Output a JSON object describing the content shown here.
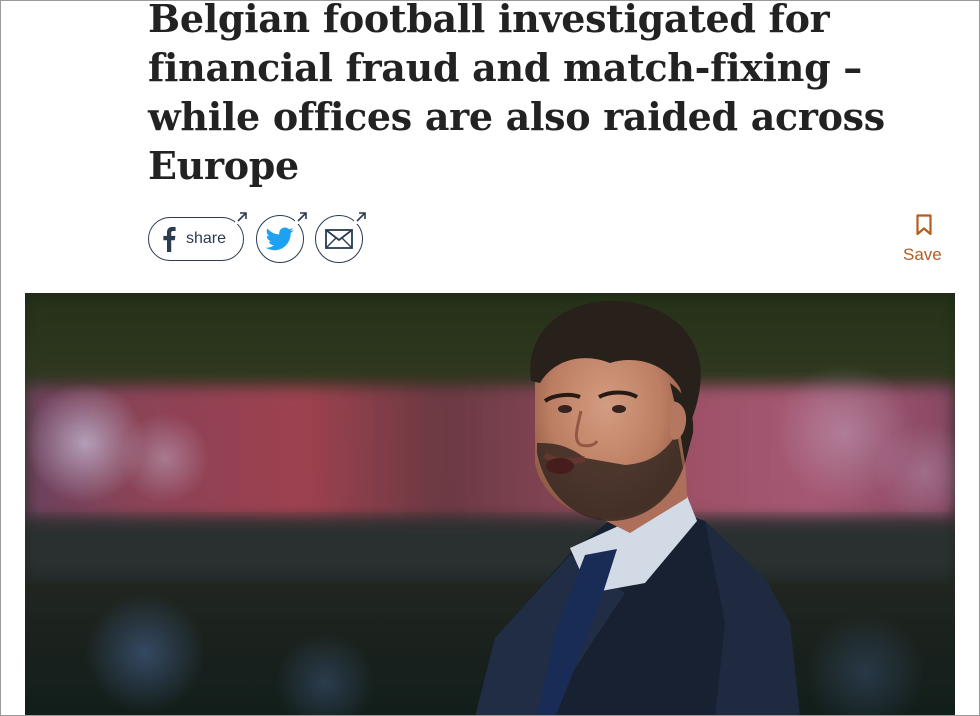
{
  "article": {
    "headline_lines": [
      "Belgian football investigated for",
      "financial fraud and match-fixing –",
      "while offices are also raided across",
      "Europe"
    ]
  },
  "share": {
    "facebook_label": "share"
  },
  "save": {
    "label": "Save"
  },
  "icons": {
    "facebook": "facebook-icon",
    "twitter": "twitter-icon",
    "email": "envelope-icon",
    "external": "external-arrow-icon",
    "bookmark": "bookmark-icon"
  },
  "colors": {
    "headline": "#222222",
    "share_outline": "#2a3b52",
    "twitter_blue": "#1da1f2",
    "save_accent": "#b35c20"
  }
}
